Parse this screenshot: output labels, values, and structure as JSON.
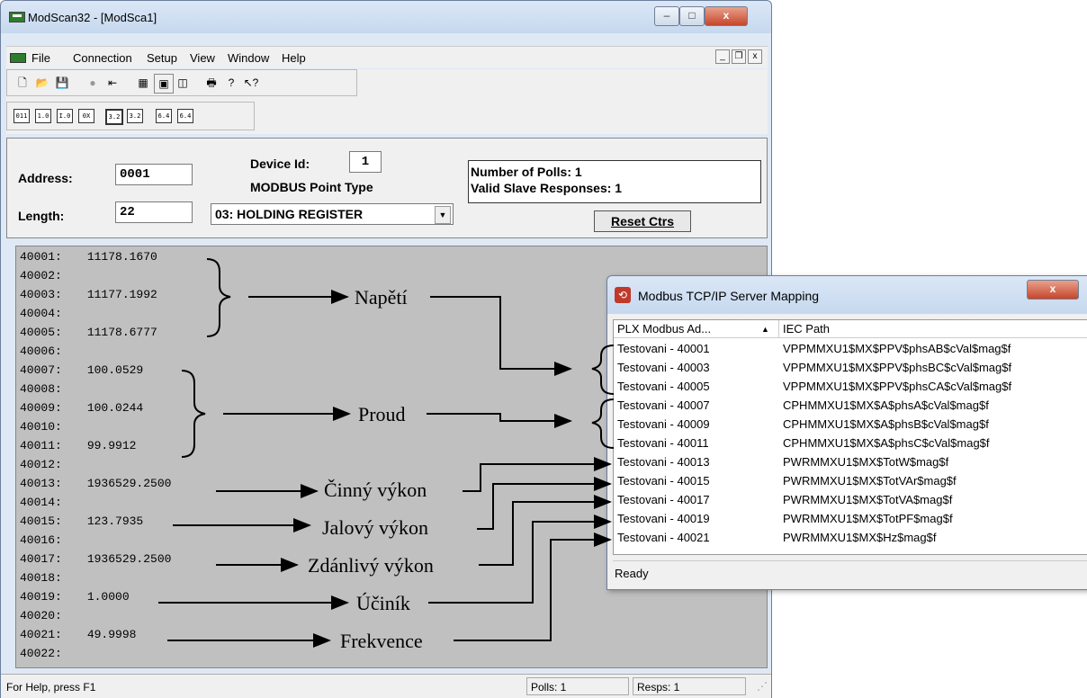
{
  "main_window": {
    "title": "ModScan32 - [ModSca1]",
    "menu": [
      "File",
      "Connection",
      "Setup",
      "View",
      "Window",
      "Help"
    ],
    "win_buttons": {
      "minimize": "–",
      "maximize": "□",
      "close": "x"
    },
    "mdi_buttons": {
      "minimize": "_",
      "restore": "❐",
      "close": "x"
    }
  },
  "panel": {
    "address_label": "Address:",
    "address_value": "0001",
    "length_label": "Length:",
    "length_value": "22",
    "device_id_label": "Device Id:",
    "device_id_value": "1",
    "point_type_label": "MODBUS Point Type",
    "point_type_value": "03: HOLDING REGISTER",
    "polls_text": "Number of Polls: 1",
    "responses_text": "Valid Slave Responses: 1",
    "reset_button": "Reset Ctrs"
  },
  "registers": [
    {
      "addr": "40001:",
      "value": "11178.1670"
    },
    {
      "addr": "40002:",
      "value": ""
    },
    {
      "addr": "40003:",
      "value": "11177.1992"
    },
    {
      "addr": "40004:",
      "value": ""
    },
    {
      "addr": "40005:",
      "value": "11178.6777"
    },
    {
      "addr": "40006:",
      "value": ""
    },
    {
      "addr": "40007:",
      "value": "100.0529"
    },
    {
      "addr": "40008:",
      "value": ""
    },
    {
      "addr": "40009:",
      "value": "100.0244"
    },
    {
      "addr": "40010:",
      "value": ""
    },
    {
      "addr": "40011:",
      "value": "99.9912"
    },
    {
      "addr": "40012:",
      "value": ""
    },
    {
      "addr": "40013:",
      "value": "1936529.2500"
    },
    {
      "addr": "40014:",
      "value": ""
    },
    {
      "addr": "40015:",
      "value": "123.7935"
    },
    {
      "addr": "40016:",
      "value": ""
    },
    {
      "addr": "40017:",
      "value": "1936529.2500"
    },
    {
      "addr": "40018:",
      "value": ""
    },
    {
      "addr": "40019:",
      "value": "1.0000"
    },
    {
      "addr": "40020:",
      "value": ""
    },
    {
      "addr": "40021:",
      "value": "49.9998"
    },
    {
      "addr": "40022:",
      "value": ""
    }
  ],
  "annotations": {
    "voltage": "Napětí",
    "current": "Proud",
    "active_power": "Činný výkon",
    "reactive_power": "Jalový výkon",
    "apparent_power": "Zdánlivý výkon",
    "power_factor": "Účiník",
    "frequency": "Frekvence"
  },
  "statusbar": {
    "help": "For Help, press F1",
    "polls": "Polls: 1",
    "resps": "Resps: 1"
  },
  "mapping_window": {
    "title": "Modbus TCP/IP Server Mapping",
    "close": "x",
    "col1": "PLX Modbus Ad...",
    "sort_arrow": "▲",
    "col2": "IEC Path",
    "rows": [
      {
        "addr": "Testovani - 40001",
        "path": "VPPMMXU1$MX$PPV$phsAB$cVal$mag$f"
      },
      {
        "addr": "Testovani - 40003",
        "path": "VPPMMXU1$MX$PPV$phsBC$cVal$mag$f"
      },
      {
        "addr": "Testovani - 40005",
        "path": "VPPMMXU1$MX$PPV$phsCA$cVal$mag$f"
      },
      {
        "addr": "Testovani - 40007",
        "path": "CPHMMXU1$MX$A$phsA$cVal$mag$f"
      },
      {
        "addr": "Testovani - 40009",
        "path": "CPHMMXU1$MX$A$phsB$cVal$mag$f"
      },
      {
        "addr": "Testovani - 40011",
        "path": "CPHMMXU1$MX$A$phsC$cVal$mag$f"
      },
      {
        "addr": "Testovani - 40013",
        "path": "PWRMMXU1$MX$TotW$mag$f"
      },
      {
        "addr": "Testovani - 40015",
        "path": "PWRMMXU1$MX$TotVAr$mag$f"
      },
      {
        "addr": "Testovani - 40017",
        "path": "PWRMMXU1$MX$TotVA$mag$f"
      },
      {
        "addr": "Testovani - 40019",
        "path": "PWRMMXU1$MX$TotPF$mag$f"
      },
      {
        "addr": "Testovani - 40021",
        "path": "PWRMMXU1$MX$Hz$mag$f"
      }
    ],
    "status": "Ready"
  }
}
